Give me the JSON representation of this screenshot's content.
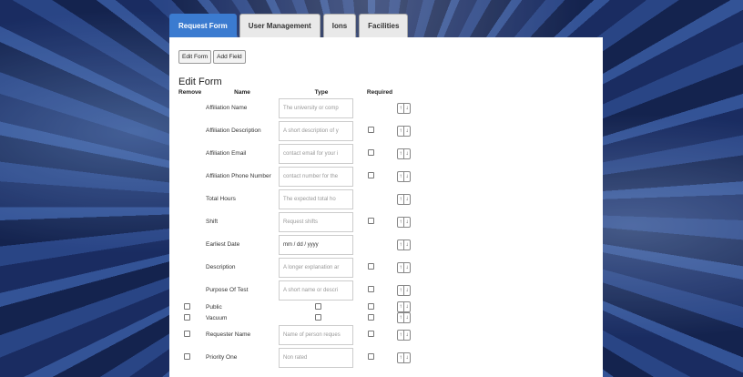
{
  "tabs": [
    {
      "label": "Request Form",
      "active": true
    },
    {
      "label": "User Management",
      "active": false
    },
    {
      "label": "Ions",
      "active": false
    },
    {
      "label": "Facilities",
      "active": false
    }
  ],
  "toolbar": {
    "edit_form": "Edit Form",
    "add_field": "Add Field"
  },
  "form_title": "Edit Form",
  "columns": {
    "remove": "Remove",
    "name": "Name",
    "type": "Type",
    "required": "Required"
  },
  "order_up": "↑",
  "order_down": "↓",
  "rows": [
    {
      "name": "Affiliation Name",
      "placeholder": "The university or comp",
      "remove_box": false,
      "required_box": false
    },
    {
      "name": "Affiliation Description",
      "placeholder": "A short description of y",
      "remove_box": false,
      "required_box": true
    },
    {
      "name": "Affiliation Email",
      "placeholder": "contact email for your i",
      "remove_box": false,
      "required_box": true
    },
    {
      "name": "Affiliation Phone Number",
      "placeholder": "contact number for the",
      "remove_box": false,
      "required_box": true
    },
    {
      "name": "Total Hours",
      "placeholder": "The expected total ho",
      "remove_box": false,
      "required_box": false
    },
    {
      "name": "Shift",
      "placeholder": "Request shifts",
      "remove_box": false,
      "required_box": true
    },
    {
      "name": "Earliest Date",
      "placeholder": "mm / dd / yyyy",
      "remove_box": false,
      "required_box": false
    },
    {
      "name": "Description",
      "placeholder": "A longer explanation ar",
      "remove_box": false,
      "required_box": true
    },
    {
      "name": "Purpose Of Test",
      "placeholder": "A short name or descri",
      "remove_box": false,
      "required_box": true
    },
    {
      "name": "Public",
      "checkbox_type": true,
      "remove_box": true,
      "required_box": true
    },
    {
      "name": "Vacuum",
      "checkbox_type": true,
      "remove_box": true,
      "required_box": true
    },
    {
      "name": "Requester Name",
      "placeholder": "Name of person reques",
      "remove_box": true,
      "required_box": true
    },
    {
      "name": "Priority One",
      "placeholder": "Non rated",
      "remove_box": true,
      "required_box": true
    }
  ]
}
